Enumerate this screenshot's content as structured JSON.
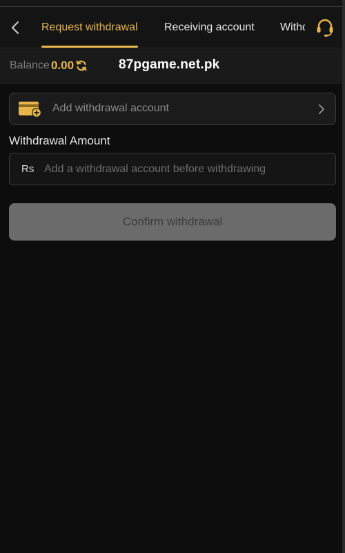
{
  "header": {
    "tabs": [
      {
        "label": "Request withdrawal",
        "active": true
      },
      {
        "label": "Receiving account",
        "active": false
      },
      {
        "label": "Withdrawal records",
        "active": false
      }
    ],
    "back_icon": "chevron-left-icon",
    "support_icon": "headset-icon"
  },
  "balance": {
    "label": "Balance",
    "value": "0.00",
    "refresh_icon": "refresh-icon",
    "watermark": "87pgame.net.pk"
  },
  "add_account": {
    "label": "Add withdrawal account",
    "icon": "add-card-icon",
    "chevron_icon": "chevron-right-icon"
  },
  "withdrawal": {
    "section_title": "Withdrawal Amount",
    "currency": "Rs",
    "placeholder": "Add a withdrawal account before withdrawing",
    "value": ""
  },
  "confirm": {
    "label": "Confirm withdrawal",
    "disabled": true
  },
  "colors": {
    "accent": "#e8b64a",
    "background": "#0d0d0d",
    "surface": "#1a1a1a",
    "border": "#3a3a3a",
    "button_disabled": "#6b6b6b"
  }
}
